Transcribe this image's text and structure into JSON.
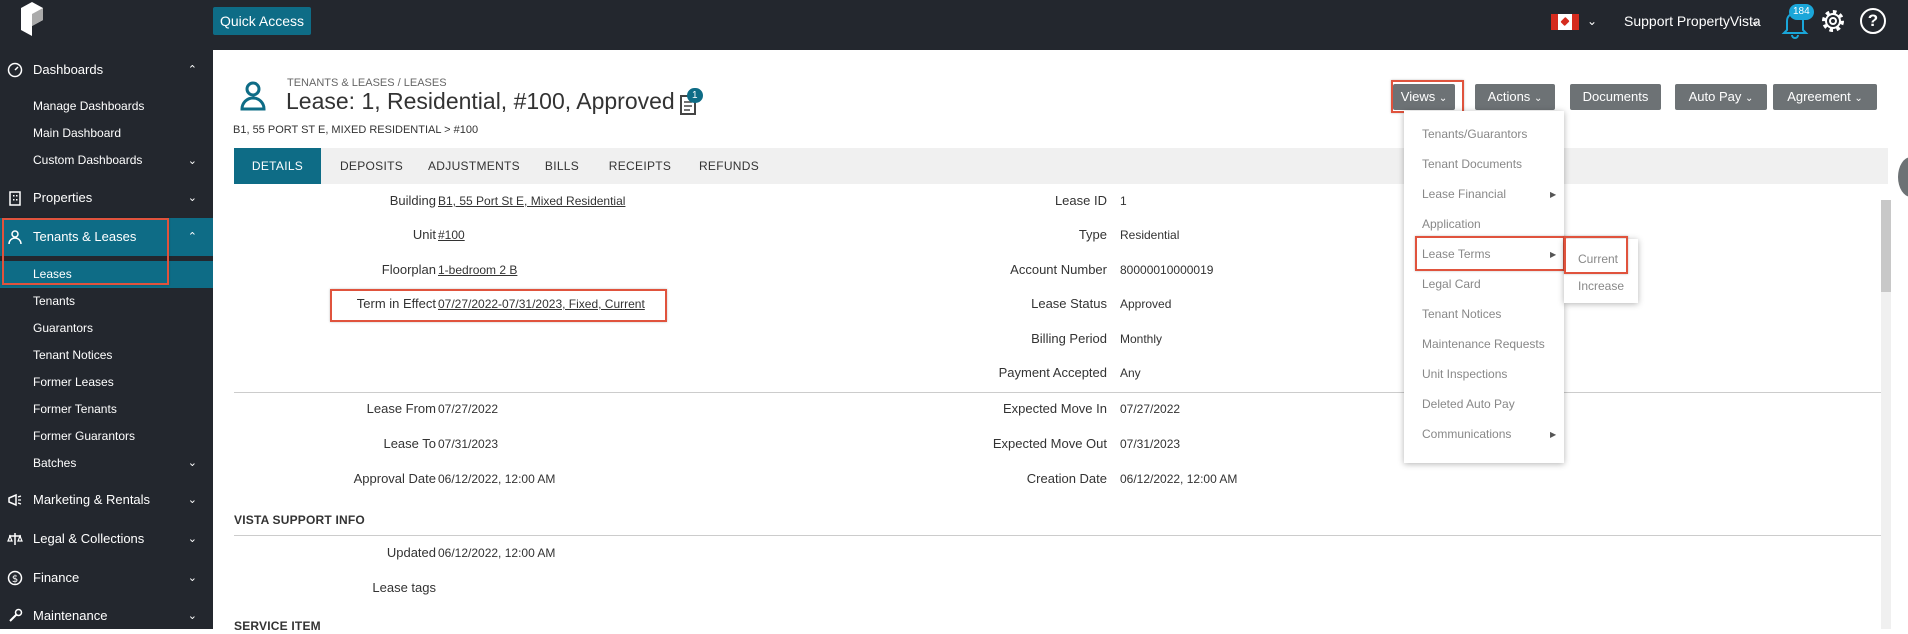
{
  "topbar": {
    "quick_access": "Quick Access",
    "user": "Support PropertyVista",
    "notifications": "184"
  },
  "sidebar": {
    "dashboards": "Dashboards",
    "dash_items": [
      "Manage Dashboards",
      "Main Dashboard",
      "Custom Dashboards"
    ],
    "properties": "Properties",
    "tenants_leases": "Tenants & Leases",
    "tl_items": [
      "Leases",
      "Tenants",
      "Guarantors",
      "Tenant Notices",
      "Former Leases",
      "Former Tenants",
      "Former Guarantors",
      "Batches"
    ],
    "marketing": "Marketing & Rentals",
    "legal": "Legal & Collections",
    "finance": "Finance",
    "maintenance": "Maintenance"
  },
  "header": {
    "breadcrumb": "TENANTS & LEASES / LEASES",
    "title": "Lease: 1, Residential, #100, Approved",
    "doc_badge": "1",
    "subtitle": "B1, 55 PORT ST E, MIXED RESIDENTIAL > #100"
  },
  "buttons": {
    "views": "Views",
    "actions": "Actions",
    "documents": "Documents",
    "autopay": "Auto Pay",
    "agreement": "Agreement"
  },
  "tabs": [
    "DETAILS",
    "DEPOSITS",
    "ADJUSTMENTS",
    "BILLS",
    "RECEIPTS",
    "REFUNDS"
  ],
  "details": {
    "building_l": "Building",
    "building_v": "B1, 55 Port St E, Mixed Residential",
    "unit_l": "Unit",
    "unit_v": "#100",
    "floorplan_l": "Floorplan",
    "floorplan_v": "1-bedroom 2 B",
    "term_l": "Term in Effect",
    "term_v": "07/27/2022-07/31/2023, Fixed, Current",
    "leaseid_l": "Lease ID",
    "leaseid_v": "1",
    "type_l": "Type",
    "type_v": "Residential",
    "acct_l": "Account Number",
    "acct_v": "80000010000019",
    "status_l": "Lease Status",
    "status_v": "Approved",
    "billing_l": "Billing Period",
    "billing_v": "Monthly",
    "payment_l": "Payment Accepted",
    "payment_v": "Any",
    "from_l": "Lease From",
    "from_v": "07/27/2022",
    "to_l": "Lease To",
    "to_v": "07/31/2023",
    "approval_l": "Approval Date",
    "approval_v": "06/12/2022, 12:00 AM",
    "emi_l": "Expected Move In",
    "emi_v": "07/27/2022",
    "emo_l": "Expected Move Out",
    "emo_v": "07/31/2023",
    "created_l": "Creation Date",
    "created_v": "06/12/2022, 12:00 AM"
  },
  "vista": {
    "heading": "VISTA SUPPORT INFO",
    "updated_l": "Updated",
    "updated_v": "06/12/2022, 12:00 AM",
    "tags_l": "Lease tags"
  },
  "service": {
    "heading": "SERVICE ITEM"
  },
  "views_menu": [
    "Tenants/Guarantors",
    "Tenant Documents",
    "Lease Financial",
    "Application",
    "Lease Terms",
    "Legal Card",
    "Tenant Notices",
    "Maintenance Requests",
    "Unit Inspections",
    "Deleted Auto Pay",
    "Communications"
  ],
  "lease_terms_submenu": [
    "Current",
    "Increase"
  ]
}
